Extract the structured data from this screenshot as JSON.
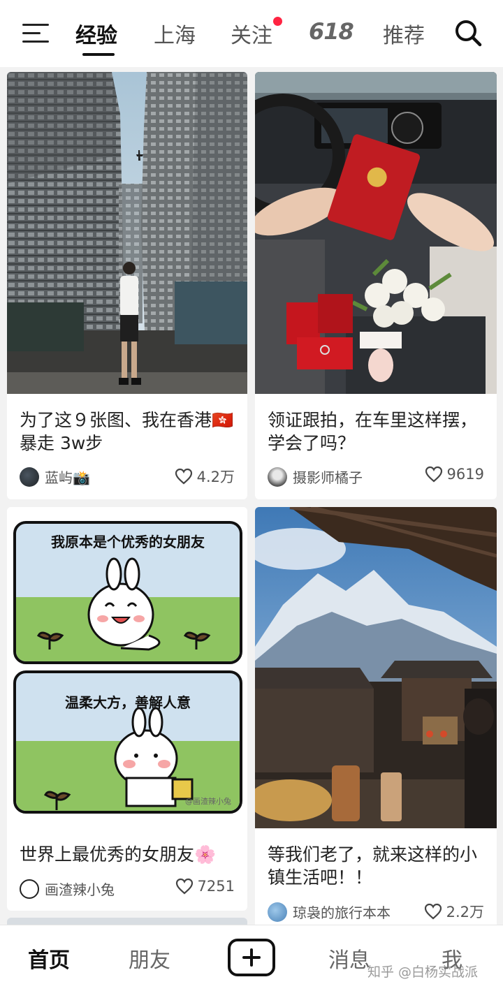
{
  "header": {
    "tabs": [
      {
        "label": "经验",
        "active": true
      },
      {
        "label": "上海"
      },
      {
        "label": "关注",
        "has_dot": true
      },
      {
        "label": "618"
      },
      {
        "label": "推荐"
      }
    ],
    "menu_icon": "menu-icon",
    "search_icon": "search-icon",
    "accent_color": "#ff2442"
  },
  "feed": {
    "cards": [
      {
        "title": "为了这９张图、我在香港🇭🇰暴走 3w步",
        "author": "蓝屿📸",
        "likes": "4.2万"
      },
      {
        "title": "领证跟拍，在车里这样摆，学会了吗？",
        "author": "摄影师橘子",
        "likes": "9619"
      },
      {
        "title": "世界上最优秀的女朋友🌸",
        "author": "画渣辣小兔",
        "likes": "7251",
        "comic_caption_1": "我原本是个优秀的女朋友",
        "comic_caption_2": "温柔大方，善解人意",
        "comic_signature": "@画渣辣小兔"
      },
      {
        "title": "等我们老了，就来这样的小镇生活吧！！",
        "author": "琼袅的旅行本本",
        "likes": "2.2万"
      }
    ]
  },
  "bottom_nav": {
    "items": [
      {
        "label": "首页",
        "active": true
      },
      {
        "label": "朋友"
      },
      {
        "label": "消息"
      },
      {
        "label": "我"
      }
    ],
    "watermark": "知乎 @白杨实战派"
  }
}
